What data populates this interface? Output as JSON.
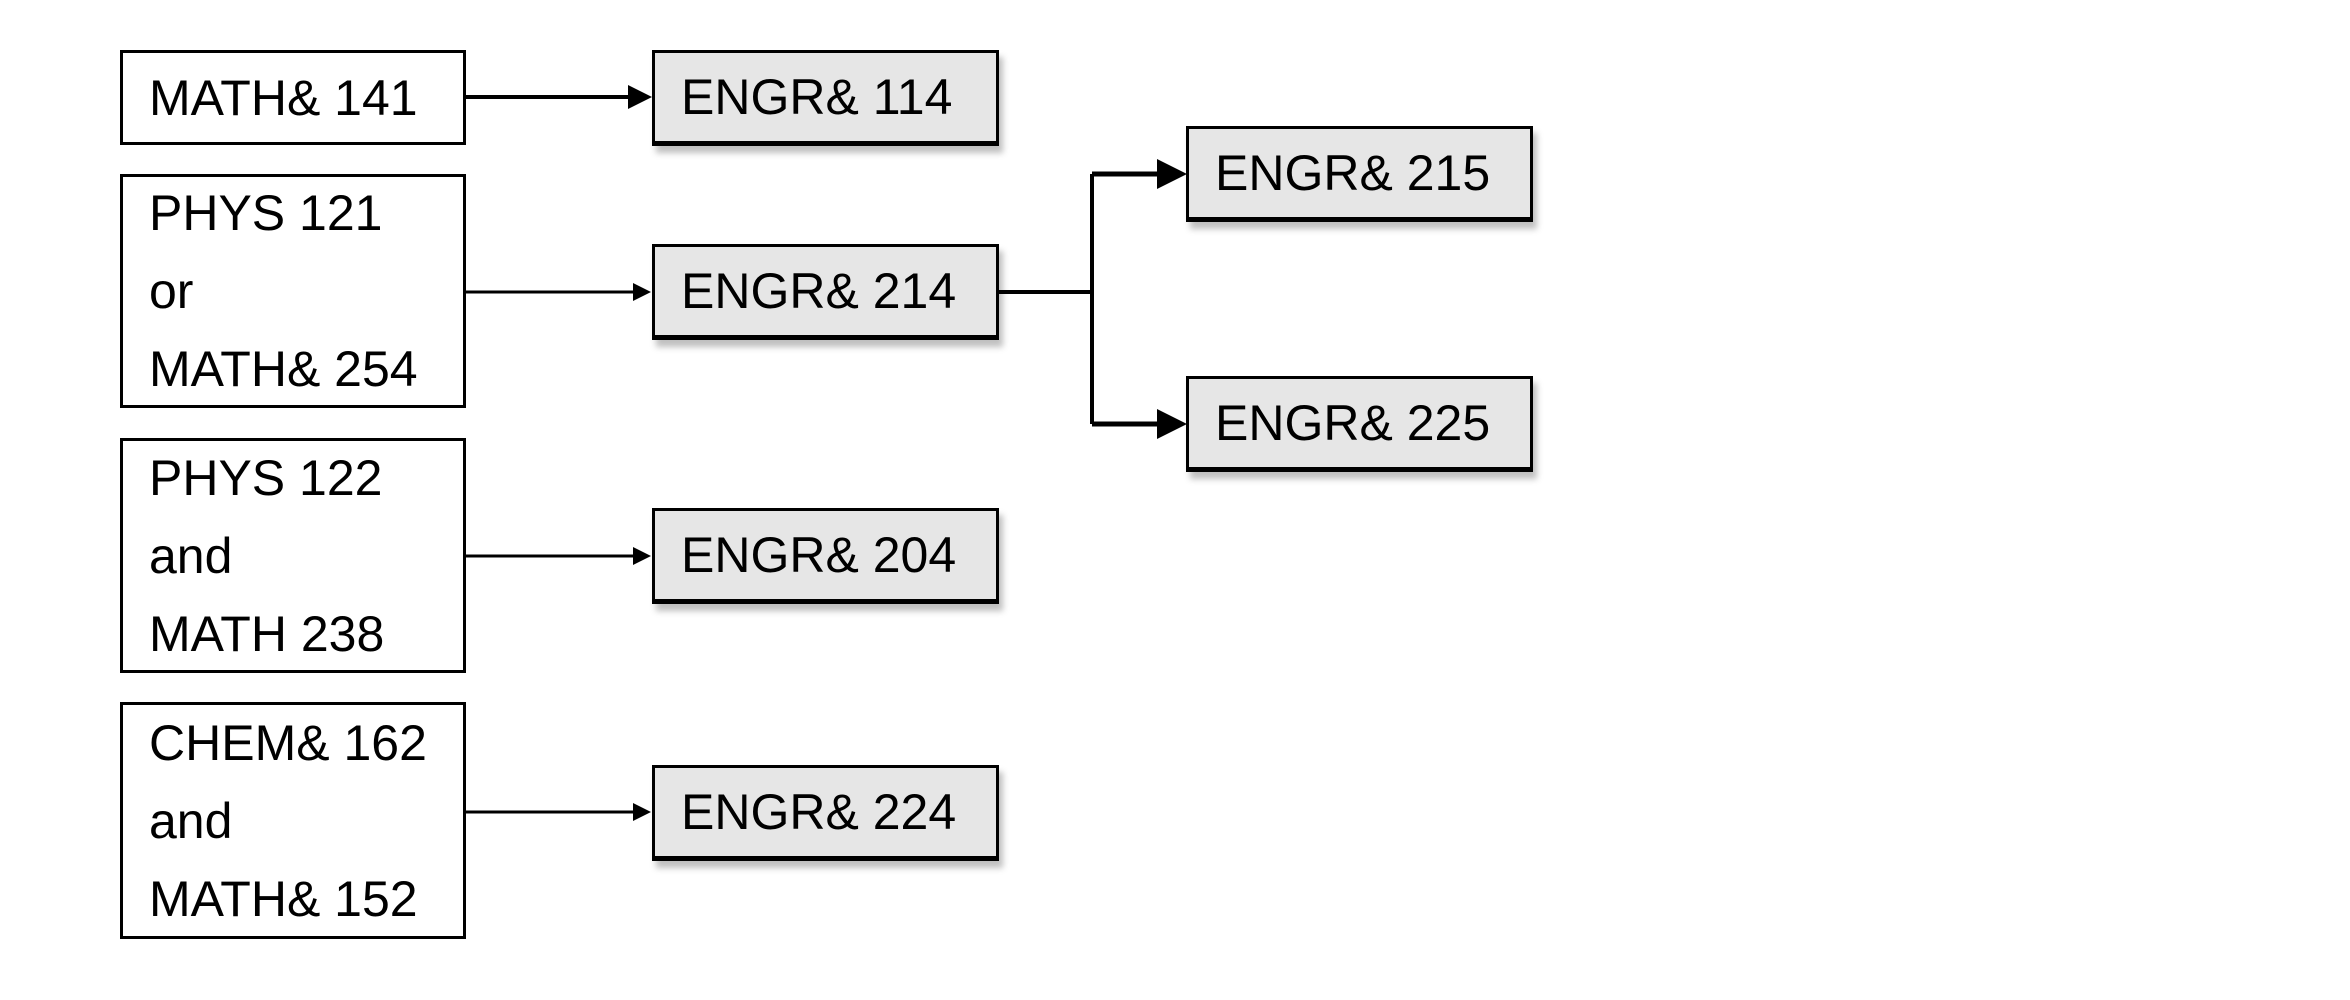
{
  "prerequisites": [
    {
      "lines": [
        "MATH& 141"
      ]
    },
    {
      "lines": [
        "PHYS 121",
        "or",
        "MATH& 254"
      ]
    },
    {
      "lines": [
        "PHYS 122",
        "and",
        "MATH 238"
      ]
    },
    {
      "lines": [
        "CHEM& 162",
        "and",
        "MATH& 152"
      ]
    }
  ],
  "courses": {
    "engr114": "ENGR& 114",
    "engr214": "ENGR& 214",
    "engr204": "ENGR& 204",
    "engr224": "ENGR& 224",
    "engr215": "ENGR& 215",
    "engr225": "ENGR& 225"
  },
  "colors": {
    "course_fill": "#e6e6e6",
    "prereq_fill": "#ffffff",
    "line": "#000000"
  }
}
